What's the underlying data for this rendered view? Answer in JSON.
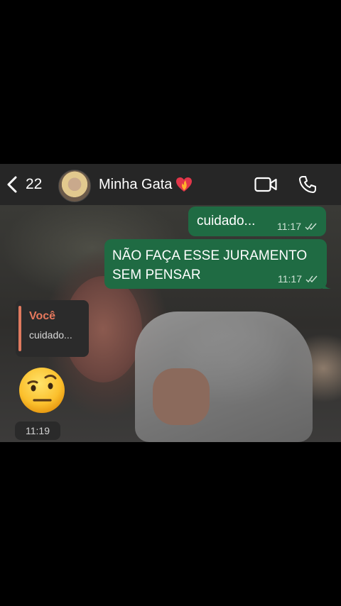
{
  "header": {
    "back_count": "22",
    "contact_name": "Minha Gata",
    "icons": [
      "chevron-left-icon",
      "heart-on-fire-emoji",
      "video-call-icon",
      "phone-call-icon"
    ]
  },
  "messages": {
    "outgoing": [
      {
        "text": "cuidado...",
        "time": "11:17",
        "status": "read"
      },
      {
        "text": "NÃO FAÇA ESSE JURAMENTO SEM PENSAR",
        "time": "11:17",
        "status": "read"
      }
    ],
    "incoming": {
      "reply_author": "Você",
      "reply_quote": "cuidado...",
      "emoji": "face-with-raised-eyebrow",
      "time": "11:19"
    }
  },
  "colors": {
    "header_bg": "#262626",
    "outgoing_bubble": "#1f6b43",
    "reply_author": "#e8795d",
    "reply_bar": "#e07a5f"
  }
}
